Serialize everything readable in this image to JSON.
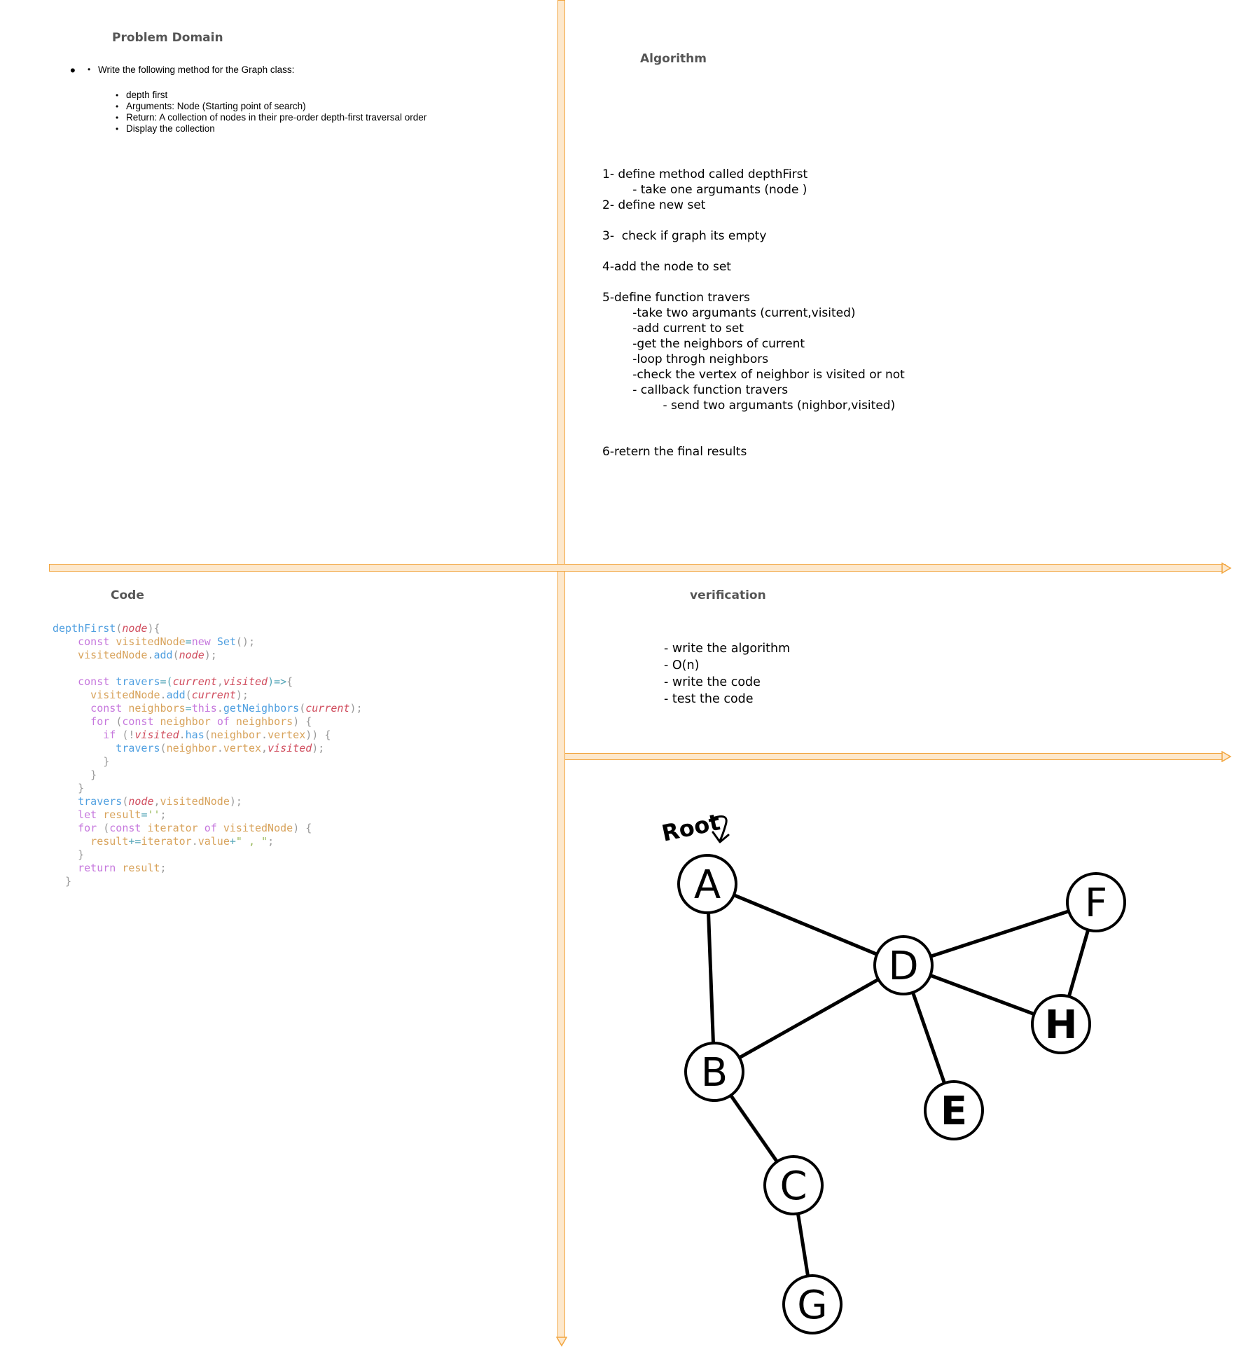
{
  "sections": {
    "problem_title": "Problem Domain",
    "algorithm_title": "Algorithm",
    "code_title": "Code",
    "verification_title": "verification"
  },
  "problem": {
    "requirement": "Write the following method for the Graph class:",
    "items": [
      "depth first",
      "Arguments: Node (Starting point of search)",
      "Return: A collection of nodes in their pre-order depth-first traversal order",
      "Display the collection"
    ]
  },
  "algorithm": {
    "lines": [
      "1- define method called depthFirst",
      "        - take one argumants (node )",
      "2- define new set",
      "",
      "3-  check if graph its empty",
      "",
      "4-add the node to set",
      "",
      "5-define function travers",
      "        -take two argumants (current,visited)",
      "        -add current to set",
      "        -get the neighbors of current",
      "        -loop throgh neighbors",
      "        -check the vertex of neighbor is visited or not",
      "        - callback function travers",
      "                - send two argumants (nighbor,visited)",
      "",
      "",
      "6-retern the final results"
    ]
  },
  "verification": {
    "items": [
      "- write the algorithm",
      "- O(n)",
      "- write the code",
      "- test the code"
    ]
  },
  "code": {
    "lines": [
      [
        [
          "f",
          "depthFirst"
        ],
        [
          "pu",
          "("
        ],
        [
          "p",
          "node"
        ],
        [
          "pu",
          "){"
        ]
      ],
      [
        [
          "k",
          "    const "
        ],
        [
          "v",
          "visitedNode"
        ],
        [
          "o",
          "="
        ],
        [
          "k",
          "new "
        ],
        [
          "f",
          "Set"
        ],
        [
          "pu",
          "();"
        ]
      ],
      [
        [
          "v",
          "    visitedNode"
        ],
        [
          "pu",
          "."
        ],
        [
          "f",
          "add"
        ],
        [
          "pu",
          "("
        ],
        [
          "p",
          "node"
        ],
        [
          "pu",
          ");"
        ]
      ],
      [],
      [
        [
          "k",
          "    const "
        ],
        [
          "f",
          "travers"
        ],
        [
          "o",
          "=("
        ],
        [
          "p",
          "current"
        ],
        [
          "pu",
          ","
        ],
        [
          "p",
          "visited"
        ],
        [
          "o",
          ")=>"
        ],
        [
          "pu",
          "{"
        ]
      ],
      [
        [
          "v",
          "      visitedNode"
        ],
        [
          "pu",
          "."
        ],
        [
          "f",
          "add"
        ],
        [
          "pu",
          "("
        ],
        [
          "p",
          "current"
        ],
        [
          "pu",
          ");"
        ]
      ],
      [
        [
          "k",
          "      const "
        ],
        [
          "v",
          "neighbors"
        ],
        [
          "o",
          "="
        ],
        [
          "k",
          "this"
        ],
        [
          "pu",
          "."
        ],
        [
          "f",
          "getNeighbors"
        ],
        [
          "pu",
          "("
        ],
        [
          "p",
          "current"
        ],
        [
          "pu",
          ");"
        ]
      ],
      [
        [
          "k",
          "      for "
        ],
        [
          "pu",
          "("
        ],
        [
          "k",
          "const "
        ],
        [
          "v",
          "neighbor "
        ],
        [
          "k",
          "of "
        ],
        [
          "v",
          "neighbors"
        ],
        [
          "pu",
          ") {"
        ]
      ],
      [
        [
          "k",
          "        if "
        ],
        [
          "pu",
          "(!"
        ],
        [
          "p",
          "visited"
        ],
        [
          "pu",
          "."
        ],
        [
          "f",
          "has"
        ],
        [
          "pu",
          "("
        ],
        [
          "v",
          "neighbor"
        ],
        [
          "pu",
          "."
        ],
        [
          "v",
          "vertex"
        ],
        [
          "pu",
          ")) {"
        ]
      ],
      [
        [
          "f",
          "          travers"
        ],
        [
          "pu",
          "("
        ],
        [
          "v",
          "neighbor"
        ],
        [
          "pu",
          "."
        ],
        [
          "v",
          "vertex"
        ],
        [
          "pu",
          ","
        ],
        [
          "p",
          "visited"
        ],
        [
          "pu",
          ");"
        ]
      ],
      [
        [
          "pu",
          "        }"
        ]
      ],
      [
        [
          "pu",
          "      }"
        ]
      ],
      [
        [
          "pu",
          "    }"
        ]
      ],
      [
        [
          "f",
          "    travers"
        ],
        [
          "pu",
          "("
        ],
        [
          "p",
          "node"
        ],
        [
          "pu",
          ","
        ],
        [
          "v",
          "visitedNode"
        ],
        [
          "pu",
          ");"
        ]
      ],
      [
        [
          "k",
          "    let "
        ],
        [
          "r",
          "result"
        ],
        [
          "o",
          "="
        ],
        [
          "s",
          "''"
        ],
        [
          "pu",
          ";"
        ]
      ],
      [
        [
          "k",
          "    for "
        ],
        [
          "pu",
          "("
        ],
        [
          "k",
          "const "
        ],
        [
          "v",
          "iterator "
        ],
        [
          "k",
          "of "
        ],
        [
          "v",
          "visitedNode"
        ],
        [
          "pu",
          ") {"
        ]
      ],
      [
        [
          "r",
          "      result"
        ],
        [
          "o",
          "+="
        ],
        [
          "v",
          "iterator"
        ],
        [
          "pu",
          "."
        ],
        [
          "r",
          "value"
        ],
        [
          "o",
          "+"
        ],
        [
          "s",
          "\" , \""
        ],
        [
          "pu",
          ";"
        ]
      ],
      [
        [
          "pu",
          "    }"
        ]
      ],
      [
        [
          "k",
          "    return "
        ],
        [
          "r",
          "result"
        ],
        [
          "pu",
          ";"
        ]
      ],
      [
        [
          "pu",
          "  }"
        ]
      ]
    ]
  },
  "graph": {
    "root_label": "Root",
    "nodes": [
      {
        "id": "A",
        "label": "A"
      },
      {
        "id": "B",
        "label": "B"
      },
      {
        "id": "C",
        "label": "C"
      },
      {
        "id": "D",
        "label": "D"
      },
      {
        "id": "E",
        "label": "E"
      },
      {
        "id": "F",
        "label": "F"
      },
      {
        "id": "G",
        "label": "G"
      },
      {
        "id": "H",
        "label": "H"
      }
    ],
    "edges": [
      [
        "A",
        "D"
      ],
      [
        "A",
        "B"
      ],
      [
        "B",
        "D"
      ],
      [
        "B",
        "C"
      ],
      [
        "C",
        "G"
      ],
      [
        "D",
        "F"
      ],
      [
        "D",
        "H"
      ],
      [
        "D",
        "E"
      ],
      [
        "F",
        "H"
      ]
    ]
  },
  "colors": {
    "divider_fill": "#fde8cc",
    "divider_stroke": "#f2a640"
  }
}
